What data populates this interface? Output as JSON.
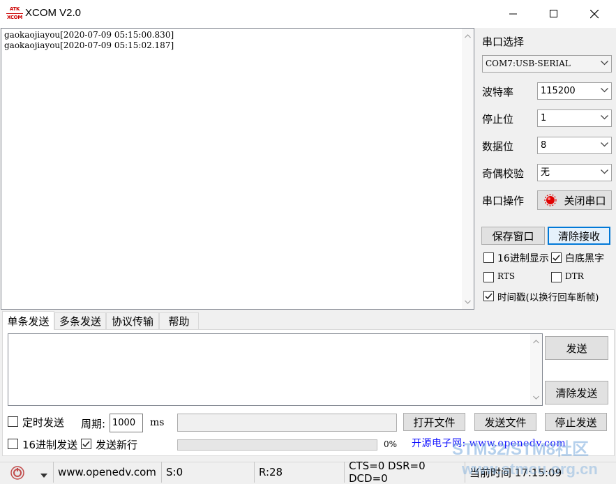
{
  "window": {
    "title": "XCOM V2.0",
    "logo_top": "ATK",
    "logo_bottom": "XCOM"
  },
  "receive": {
    "lines": [
      "gaokaojiayou[2020-07-09 05:15:00.830]",
      "gaokaojiayou[2020-07-09 05:15:02.187]"
    ]
  },
  "settings": {
    "port_label": "串口选择",
    "port_value": "COM7:USB-SERIAL",
    "baud_label": "波特率",
    "baud_value": "115200",
    "stop_label": "停止位",
    "stop_value": "1",
    "data_label": "数据位",
    "data_value": "8",
    "parity_label": "奇偶校验",
    "parity_value": "无",
    "op_label": "串口操作",
    "op_button": "关闭串口",
    "save_window": "保存窗口",
    "clear_receive": "清除接收",
    "hex_display": "16进制显示",
    "white_bg": "白底黑字",
    "rts": "RTS",
    "dtr": "DTR",
    "timestamp": "时间戳(以换行回车断帧)"
  },
  "checks": {
    "hex_display": false,
    "white_bg": true,
    "rts": false,
    "dtr": false,
    "timestamp": true,
    "timed_send": false,
    "hex_send": false,
    "send_newline": true
  },
  "tabs": [
    "单条发送",
    "多条发送",
    "协议传输",
    "帮助"
  ],
  "send": {
    "send_button": "发送",
    "clear_send_button": "清除发送",
    "timed_send": "定时发送",
    "period_label": "周期:",
    "period_value": "1000",
    "period_unit": "ms",
    "open_file": "打开文件",
    "send_file": "发送文件",
    "stop_send": "停止发送",
    "hex_send": "16进制发送",
    "send_newline": "发送新行",
    "progress_percent": "0%",
    "progress_value": 0,
    "banner": "开源电子网: www.openedv.com"
  },
  "status": {
    "website": "www.openedv.com",
    "sent": "S:0",
    "received": "R:28",
    "lines": "CTS=0 DSR=0 DCD=0",
    "time": "当前时间 17:15:09"
  },
  "watermark": {
    "line1": "STM32/STM8社区",
    "line2": "www.stmcu.org.cn"
  },
  "colors": {
    "accent": "#0078d7",
    "banner_text": "#1010ff",
    "close_port_icon": "#e00000"
  }
}
